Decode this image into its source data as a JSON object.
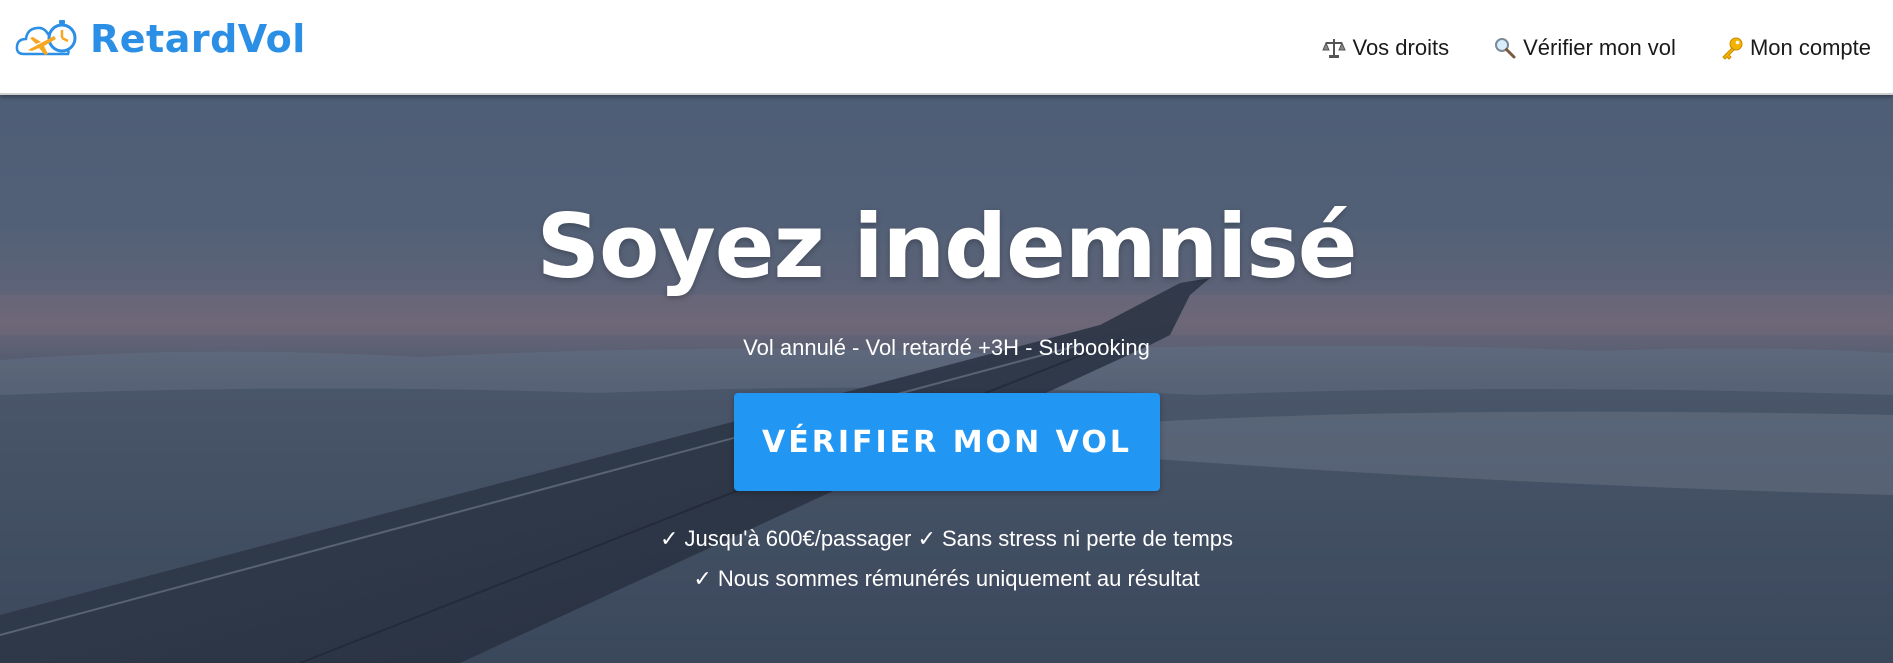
{
  "brand": {
    "name": "RetardVol",
    "logo_icon": "airplane-cloud-clock-logo",
    "brand_color": "#2b8fe6"
  },
  "nav": {
    "items": [
      {
        "label": "Vos droits",
        "icon": "scales-icon"
      },
      {
        "label": "Vérifier mon vol",
        "icon": "magnifier-icon"
      },
      {
        "label": "Mon compte",
        "icon": "key-icon"
      }
    ]
  },
  "hero": {
    "title": "Soyez indemnisé",
    "subtitle": "Vol annulé - Vol retardé +3H - Surbooking",
    "cta_label": "VÉRIFIER MON VOL",
    "cta_color": "#2196f3",
    "benefits": [
      "✓ Jusqu'à 600€/passager ✓ Sans stress ni perte de temps",
      "✓ Nous sommes rémunérés uniquement au résultat"
    ],
    "background": "airplane-wing-above-clouds-at-dusk"
  }
}
